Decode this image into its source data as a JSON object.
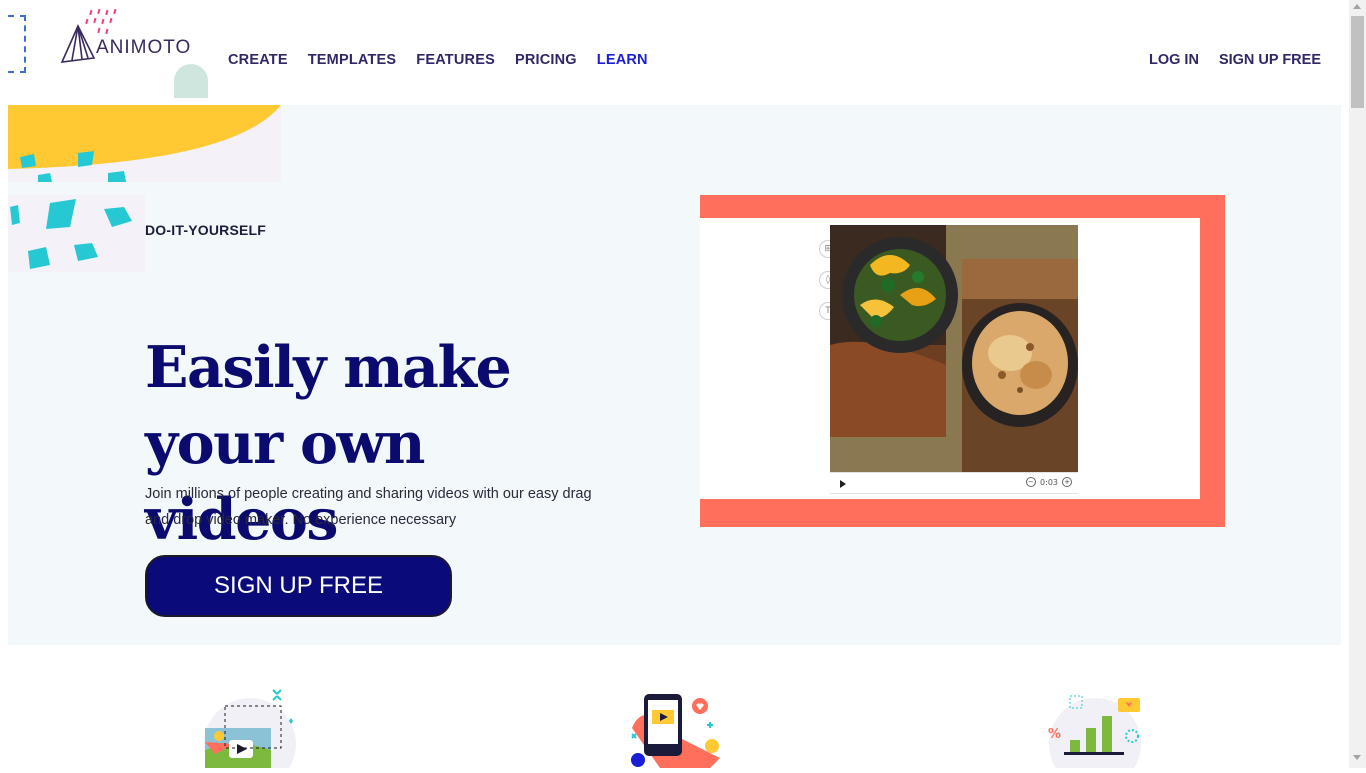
{
  "brand": {
    "name": "ANIMOTO",
    "accent_color": "#1a1ed6",
    "navy_color": "#0a0a7a",
    "coral_color": "#ff6f5b",
    "yellow_color": "#ffc933",
    "teal_color": "#26c9d3"
  },
  "nav": {
    "create": "CREATE",
    "templates": "TEMPLATES",
    "features": "FEATURES",
    "pricing": "PRICING",
    "learn": "LEARN",
    "login": "LOG IN",
    "signup": "SIGN UP FREE"
  },
  "hero": {
    "eyebrow": "DO-IT-YOURSELF",
    "headline": "Easily make your own videos",
    "subtext": "Join millions of people creating and sharing videos with our easy drag and drop video maker. No experience necessary",
    "cta": "SIGN UP FREE"
  },
  "editor_preview": {
    "time": "0:03",
    "tools": [
      "layout-icon",
      "color-drop-icon",
      "text-icon"
    ]
  },
  "features": {
    "icons": [
      "photo-video-illustration",
      "mobile-video-illustration",
      "analytics-chart-illustration"
    ]
  }
}
